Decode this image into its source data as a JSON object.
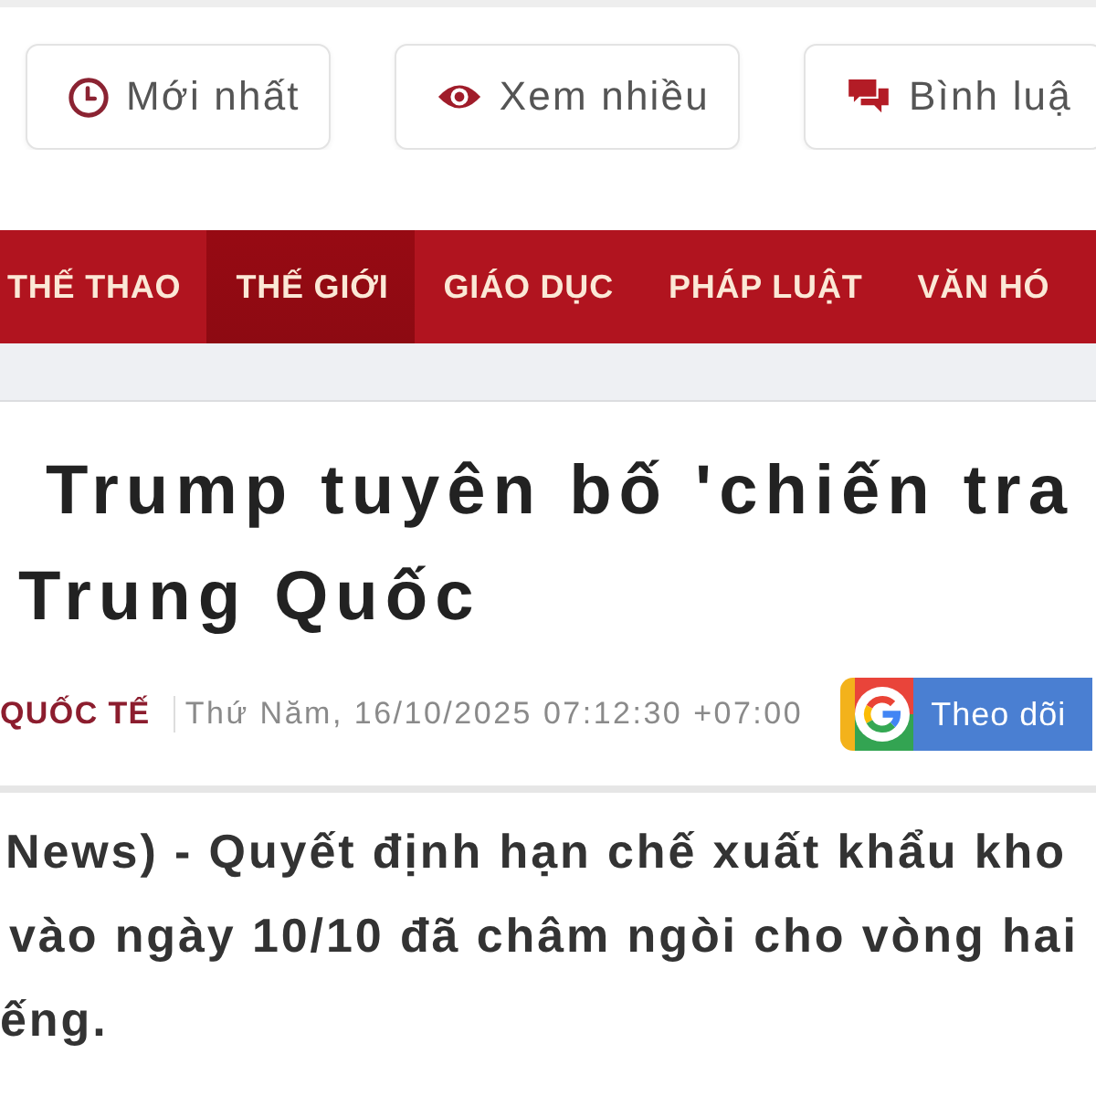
{
  "shortcuts": [
    {
      "kind": "clock",
      "label": "Mới nhất"
    },
    {
      "kind": "eye",
      "label": "Xem nhiều"
    },
    {
      "kind": "comments",
      "label": "Bình luậ"
    }
  ],
  "nav": {
    "items": [
      {
        "label": "THẾ THAO",
        "selected": false
      },
      {
        "label": "THẾ GIỚI",
        "selected": true
      },
      {
        "label": "GIÁO DỤC",
        "selected": false
      },
      {
        "label": "PHÁP LUẬT",
        "selected": false
      },
      {
        "label": "VĂN HÓ",
        "selected": false
      }
    ]
  },
  "article": {
    "title_lines": [
      "Trump tuyên bố 'chiến tra",
      "Trung Quốc"
    ],
    "category": "QUỐC TẾ",
    "date": "Thứ Năm, 16/10/2025 07:12:30 +07:00",
    "follow_button": "Theo dõi",
    "lead_lines": [
      "News) - Quyết định hạn chế xuất khẩu kho",
      "vào ngày 10/10 đã châm ngòi cho vòng hai",
      "ếng."
    ]
  }
}
